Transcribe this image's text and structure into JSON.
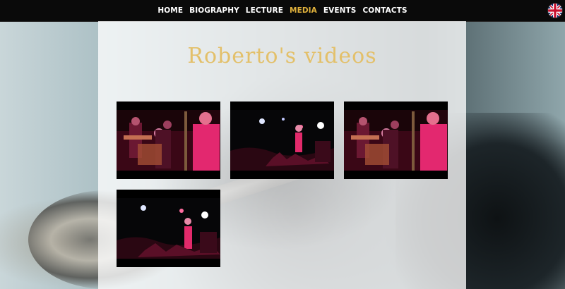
{
  "nav": {
    "items": [
      {
        "label": "HOME",
        "active": false
      },
      {
        "label": "BIOGRAPHY",
        "active": false
      },
      {
        "label": "LECTURE",
        "active": false
      },
      {
        "label": "MEDIA",
        "active": true
      },
      {
        "label": "EVENTS",
        "active": false
      },
      {
        "label": "CONTACTS",
        "active": false
      }
    ],
    "language_icon": "uk-flag-icon"
  },
  "main": {
    "title": "Roberto's videos",
    "videos": [
      {
        "scene": "band-on-stage"
      },
      {
        "scene": "dancer-in-crowd"
      },
      {
        "scene": "band-on-stage"
      },
      {
        "scene": "dancer-in-crowd"
      }
    ]
  },
  "colors": {
    "nav_background": "#0a0a0a",
    "nav_text": "#ffffff",
    "nav_active": "#e1b23c",
    "title": "#e3c06a",
    "panel": "#ffffffc7"
  }
}
